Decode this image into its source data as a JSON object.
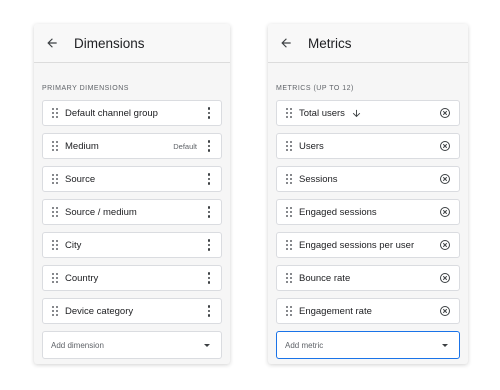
{
  "dimensions_panel": {
    "title": "Dimensions",
    "section_label": "PRIMARY DIMENSIONS",
    "items": [
      {
        "label": "Default channel group",
        "badge": ""
      },
      {
        "label": "Medium",
        "badge": "Default"
      },
      {
        "label": "Source",
        "badge": ""
      },
      {
        "label": "Source / medium",
        "badge": ""
      },
      {
        "label": "City",
        "badge": ""
      },
      {
        "label": "Country",
        "badge": ""
      },
      {
        "label": "Device category",
        "badge": ""
      }
    ],
    "add_label": "Add dimension"
  },
  "metrics_panel": {
    "title": "Metrics",
    "section_label": "METRICS (UP TO 12)",
    "items": [
      {
        "label": "Total users"
      },
      {
        "label": "Users"
      },
      {
        "label": "Sessions"
      },
      {
        "label": "Engaged sessions"
      },
      {
        "label": "Engaged sessions per user"
      },
      {
        "label": "Bounce rate"
      },
      {
        "label": "Engagement rate"
      }
    ],
    "add_label": "Add metric"
  },
  "icons": {
    "back": "arrow-left-icon",
    "drag": "drag-handle-icon",
    "more": "more-vert-icon",
    "sort": "arrow-down-icon",
    "remove": "close-circle-icon",
    "dropdown": "caret-down-icon"
  },
  "colors": {
    "accent": "#1a73e8",
    "panel_bg": "#f6f6f6",
    "item_border": "#dadce0",
    "text": "#202124",
    "muted": "#5f6368"
  }
}
